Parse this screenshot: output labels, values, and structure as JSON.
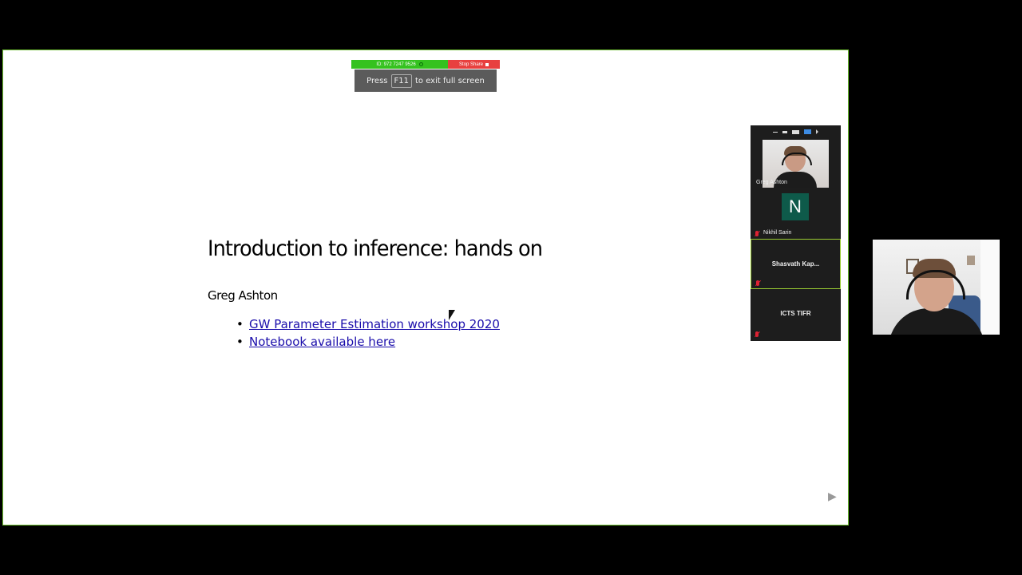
{
  "share_toolbar": {
    "meeting_id": "ID: 972 7247 9526",
    "stop_label": "Stop Share",
    "colors": {
      "id_bg": "#35c21f",
      "stop_bg": "#e8403f"
    }
  },
  "fullscreen_hint": {
    "prefix": "Press",
    "key": "F11",
    "suffix": "to exit full screen"
  },
  "slide": {
    "title": "Introduction to inference: hands on",
    "author": "Greg Ashton",
    "links": [
      "GW Parameter Estimation workshop 2020",
      "Notebook available here"
    ],
    "next_icon": "play-triangle-icon"
  },
  "gallery": {
    "participants": [
      {
        "name": "Greg Ashton",
        "type": "video"
      },
      {
        "name": "Nikhil Sarin",
        "type": "avatar",
        "initial": "N",
        "muted": true
      },
      {
        "name": "Shasvath Kap...",
        "type": "name",
        "muted": true,
        "active_speaker": true
      },
      {
        "name": "ICTS TIFR",
        "type": "name",
        "muted": true
      }
    ]
  },
  "self_view": {
    "description_icon": "webcam-video"
  },
  "colors": {
    "frame_border": "#6bbf2e",
    "link": "#1a0dab",
    "active_tile": "#9acd32"
  }
}
